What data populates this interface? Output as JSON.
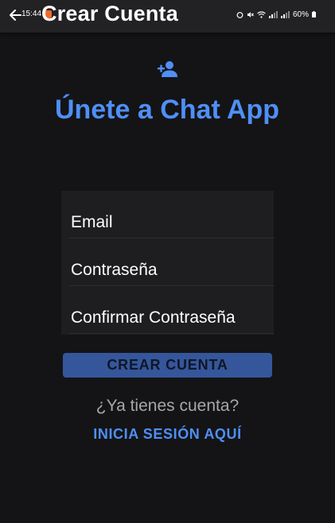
{
  "status_bar": {
    "time": "15:44",
    "battery": "60%"
  },
  "app_bar": {
    "title": "Crear Cuenta",
    "back_icon": "arrow-left-icon"
  },
  "header": {
    "icon": "person-add-icon",
    "welcome_text": "Únete a Chat App"
  },
  "form": {
    "email_label": "Email",
    "password_label": "Contraseña",
    "confirm_password_label": "Confirmar Contraseña"
  },
  "actions": {
    "create_account_label": "CREAR CUENTA",
    "have_account_text": "¿Ya tienes cuenta?",
    "login_link_label": "INICIA SESIÓN AQUÍ"
  },
  "colors": {
    "background": "#141416",
    "accent": "#4f8ff7",
    "button": "#35569a"
  }
}
